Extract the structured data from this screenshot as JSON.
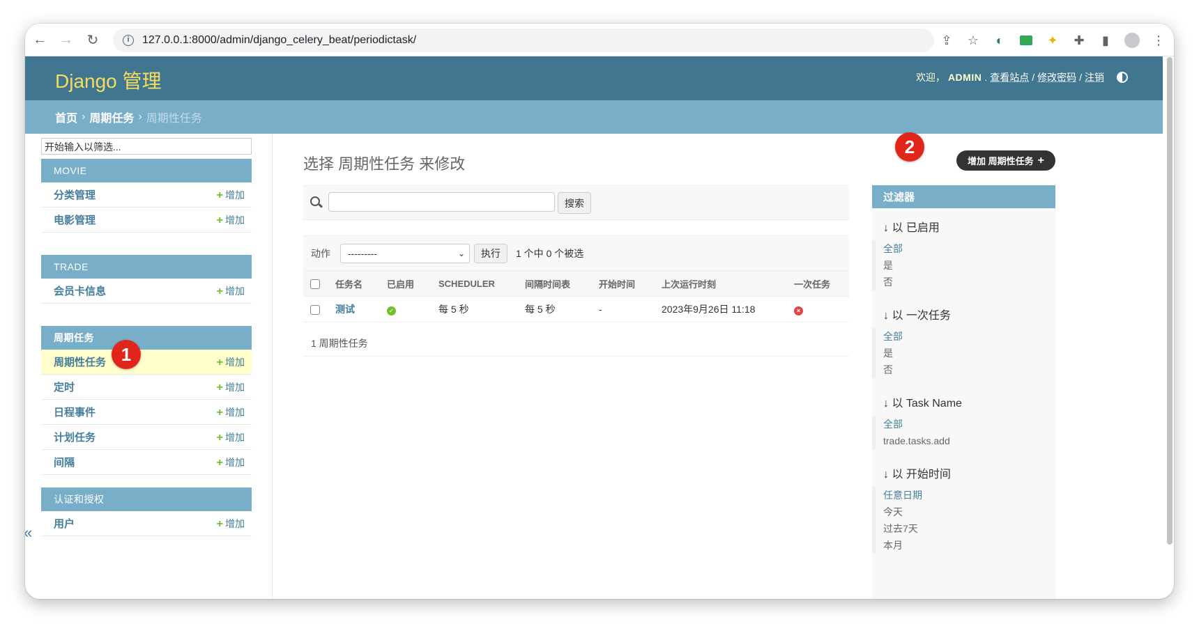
{
  "browser": {
    "url": "127.0.0.1:8000/admin/django_celery_beat/periodictask/"
  },
  "header": {
    "branding": "Django 管理",
    "welcome": "欢迎，",
    "username": "ADMIN",
    "view_site": "查看站点",
    "change_password": "修改密码",
    "logout": "注销"
  },
  "breadcrumbs": {
    "home": "首页",
    "app": "周期任务",
    "current": "周期性任务"
  },
  "sidebar": {
    "filter_placeholder": "开始输入以筛选...",
    "add_label": "增加",
    "modules": [
      {
        "caption": "MOVIE",
        "items": [
          "分类管理",
          "电影管理"
        ]
      },
      {
        "caption": "TRADE",
        "items": [
          "会员卡信息"
        ]
      },
      {
        "caption": "周期任务",
        "items": [
          "周期性任务",
          "定时",
          "日程事件",
          "计划任务",
          "间隔"
        ]
      },
      {
        "caption": "认证和授权",
        "items": [
          "用户"
        ]
      }
    ]
  },
  "content": {
    "title": "选择 周期性任务 来修改",
    "add_button": "增加 周期性任务",
    "search_button": "搜索",
    "action_label": "动作",
    "action_select": "---------",
    "go_button": "执行",
    "counter": "1 个中 0 个被选",
    "columns": [
      "任务名",
      "已启用",
      "SCHEDULER",
      "间隔时间表",
      "开始时间",
      "上次运行时刻",
      "一次任务"
    ],
    "rows": [
      {
        "name": "测试",
        "enabled": true,
        "scheduler": "每 5 秒",
        "interval": "每 5 秒",
        "start_time": "-",
        "last_run": "2023年9月26日 11:18",
        "one_off": false
      }
    ],
    "paginator": "1 周期性任务"
  },
  "filter": {
    "caption": "过滤器",
    "groups": [
      {
        "title": "以 已启用",
        "options": [
          "全部",
          "是",
          "否"
        ]
      },
      {
        "title": "以 一次任务",
        "options": [
          "全部",
          "是",
          "否"
        ]
      },
      {
        "title": "以 Task Name",
        "options": [
          "全部",
          "trade.tasks.add"
        ]
      },
      {
        "title": "以 开始时间",
        "options": [
          "任意日期",
          "今天",
          "过去7天",
          "本月"
        ]
      }
    ]
  },
  "annotations": {
    "badge1": "1",
    "badge2": "2"
  },
  "colors": {
    "header": "#417690",
    "module": "#79aec8",
    "link": "#447e9b",
    "add_plus": "#70bf2b",
    "badge": "#e0261b"
  }
}
